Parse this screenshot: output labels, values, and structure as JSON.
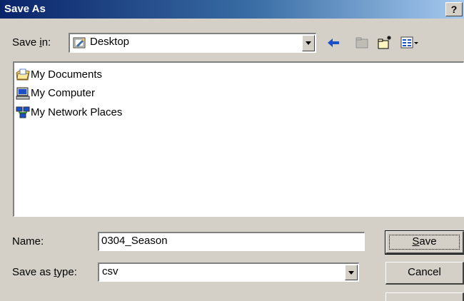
{
  "window": {
    "title": "Save As",
    "help_label": "?"
  },
  "save_in": {
    "label_prefix": "Save ",
    "label_mnemonic": "i",
    "label_suffix": "n:",
    "value": "Desktop"
  },
  "file_list": {
    "items": [
      {
        "label": "My Documents",
        "icon": "my-documents-icon"
      },
      {
        "label": "My Computer",
        "icon": "my-computer-icon"
      },
      {
        "label": "My Network Places",
        "icon": "network-places-icon"
      }
    ]
  },
  "name_field": {
    "label": "Name:",
    "value": "0304_Season"
  },
  "type_field": {
    "label_prefix": "Save as ",
    "label_mnemonic": "t",
    "label_suffix": "ype:",
    "value": "csv"
  },
  "buttons": {
    "save_mnemonic": "S",
    "save_rest": "ave",
    "cancel": "Cancel"
  }
}
